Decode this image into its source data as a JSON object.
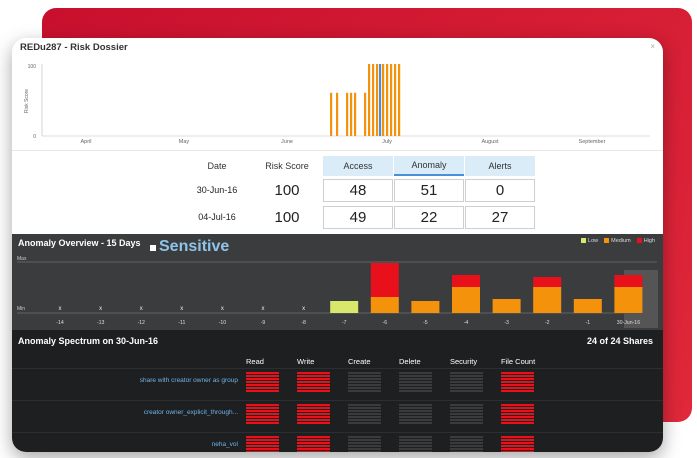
{
  "window": {
    "title": "REDu287 - Risk Dossier",
    "close": "×"
  },
  "top_chart": {
    "y_top": "100",
    "y_bottom": "0",
    "ylabel": "Risk Score",
    "months": [
      "April",
      "May",
      "June",
      "July",
      "August",
      "September"
    ]
  },
  "score_table": {
    "headers": {
      "date": "Date",
      "risk": "Risk Score",
      "access": "Access",
      "anomaly": "Anomaly",
      "alerts": "Alerts"
    },
    "rows": [
      {
        "date": "30-Jun-16",
        "risk": "100",
        "access": "48",
        "anomaly": "51",
        "alerts": "0"
      },
      {
        "date": "04-Jul-16",
        "risk": "100",
        "access": "49",
        "anomaly": "22",
        "alerts": "27"
      }
    ]
  },
  "overview": {
    "title": "Anomaly Overview - 15 Days",
    "sensitive": "Sensitive",
    "legend": [
      {
        "label": "Low",
        "color": "#d8e86a"
      },
      {
        "label": "Medium",
        "color": "#f5920c"
      },
      {
        "label": "High",
        "color": "#e8101a"
      }
    ],
    "max_label": "Max",
    "min_label": "Min",
    "days": [
      "-14",
      "-13",
      "-12",
      "-11",
      "-10",
      "-9",
      "-8",
      "-7",
      "-6",
      "-5",
      "-4",
      "-3",
      "-2",
      "-1",
      "30-Jun-16"
    ]
  },
  "spectrum": {
    "title": "Anomaly Spectrum on 30-Jun-16",
    "count": "24 of 24 Shares",
    "columns": [
      "Read",
      "Write",
      "Create",
      "Delete",
      "Security",
      "File Count"
    ],
    "rows": [
      {
        "label": "share with creator owner as group"
      },
      {
        "label": "creator owner_explicit_through..."
      },
      {
        "label": "neha_vol"
      }
    ]
  }
}
